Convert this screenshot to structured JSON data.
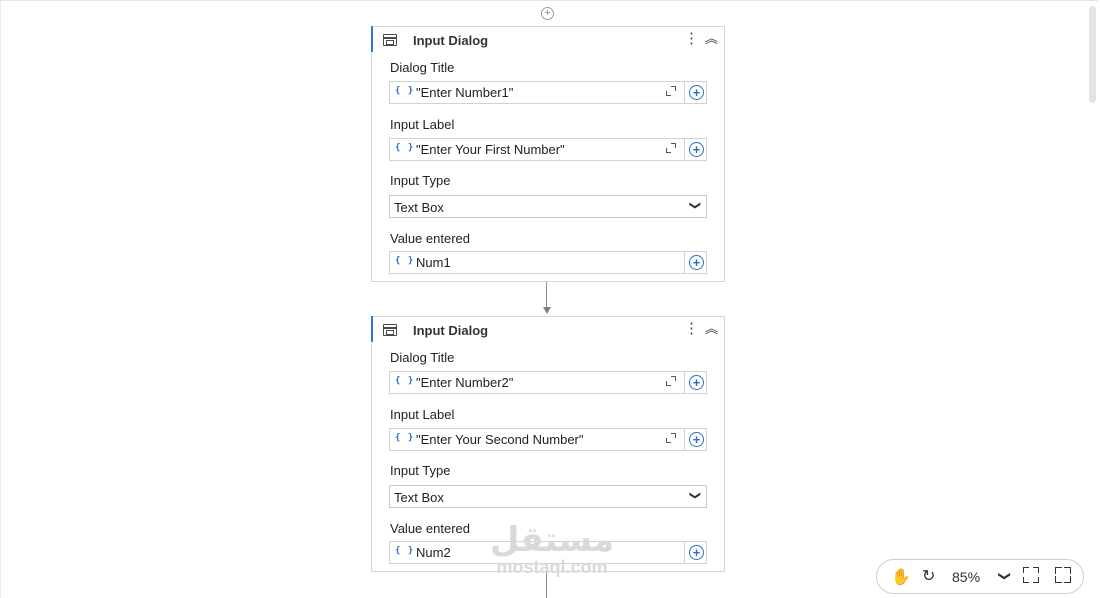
{
  "canvas": {
    "add_icon": "plus-circle-icon",
    "activities": [
      {
        "title": "Input Dialog",
        "fields": {
          "dialog_title_label": "Dialog Title",
          "dialog_title_value": "\"Enter Number1\"",
          "input_label_label": "Input Label",
          "input_label_value": "\"Enter Your First Number\"",
          "input_type_label": "Input Type",
          "input_type_value": "Text Box",
          "value_entered_label": "Value entered",
          "value_entered_value": "Num1"
        }
      },
      {
        "title": "Input Dialog",
        "fields": {
          "dialog_title_label": "Dialog Title",
          "dialog_title_value": "\"Enter Number2\"",
          "input_label_label": "Input Label",
          "input_label_value": "\"Enter Your Second Number\"",
          "input_type_label": "Input Type",
          "input_type_value": "Text Box",
          "value_entered_label": "Value entered",
          "value_entered_value": "Num2"
        }
      }
    ],
    "expression_badge": "{ }"
  },
  "zoom_toolbar": {
    "zoom_level": "85%",
    "icons": [
      "hand-icon",
      "reset-view-icon",
      "chevron-down-icon",
      "fit-to-screen-icon",
      "fullscreen-icon"
    ]
  },
  "watermark": {
    "arabic": "مستقل",
    "latin": "mostaql.com"
  },
  "colors": {
    "accent": "#2c7ad6",
    "expression": "#2c6fc2",
    "border": "#d6d6d6"
  }
}
